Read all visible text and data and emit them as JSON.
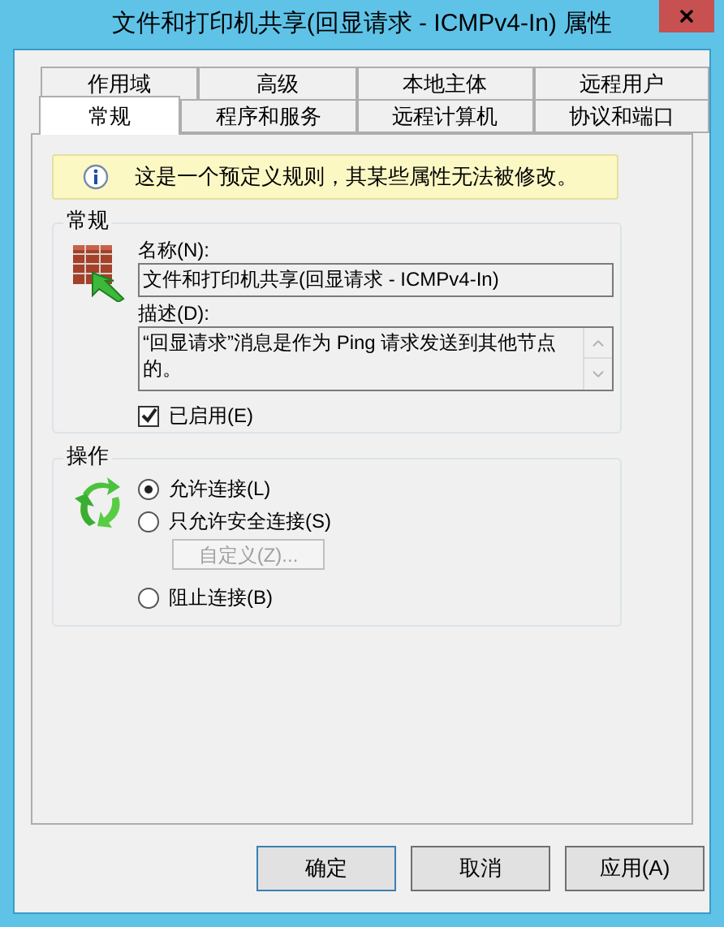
{
  "window": {
    "title": "文件和打印机共享(回显请求 - ICMPv4-In) 属性"
  },
  "tab_rows": [
    [
      {
        "label": "作用域",
        "selected": false
      },
      {
        "label": "高级",
        "selected": false
      },
      {
        "label": "本地主体",
        "selected": false
      },
      {
        "label": "远程用户",
        "selected": false
      }
    ],
    [
      {
        "label": "常规",
        "selected": true
      },
      {
        "label": "程序和服务",
        "selected": false
      },
      {
        "label": "远程计算机",
        "selected": false
      },
      {
        "label": "协议和端口",
        "selected": false
      }
    ]
  ],
  "info_message": "这是一个预定义规则，其某些属性无法被修改。",
  "general": {
    "title": "常规",
    "name_label": "名称(N):",
    "name_value": "文件和打印机共享(回显请求 - ICMPv4-In)",
    "description_label": "描述(D):",
    "description_value": "“回显请求”消息是作为 Ping 请求发送到其他节点的。",
    "enabled": {
      "label": "已启用(E)",
      "checked": true
    }
  },
  "action": {
    "title": "操作",
    "options": [
      {
        "label": "允许连接(L)",
        "selected": true
      },
      {
        "label": "只允许安全连接(S)",
        "selected": false,
        "button": {
          "label": "自定义(Z)...",
          "disabled": true
        }
      },
      {
        "label": "阻止连接(B)",
        "selected": false
      }
    ]
  },
  "buttons": [
    {
      "label": "确定",
      "default": true
    },
    {
      "label": "取消",
      "default": false
    },
    {
      "label": "应用(A)",
      "default": false
    }
  ]
}
